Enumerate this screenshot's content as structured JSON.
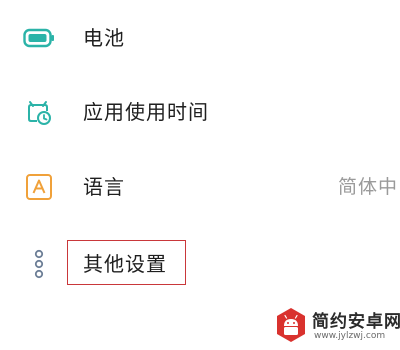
{
  "settings": {
    "items": [
      {
        "label": "电池",
        "icon": "battery-icon",
        "value": ""
      },
      {
        "label": "应用使用时间",
        "icon": "app-usage-clock-icon",
        "value": ""
      },
      {
        "label": "语言",
        "icon": "language-icon",
        "value": "简体中"
      },
      {
        "label": "其他设置",
        "icon": "more-dots-icon",
        "value": ""
      }
    ]
  },
  "colors": {
    "accent_teal": "#2bb3a8",
    "language_orange": "#f0a13a",
    "highlight_red": "#c9373a",
    "dots_blue": "#6c7e96"
  },
  "watermark": {
    "title": "简约安卓网",
    "url": "www.jylzwj.com"
  }
}
